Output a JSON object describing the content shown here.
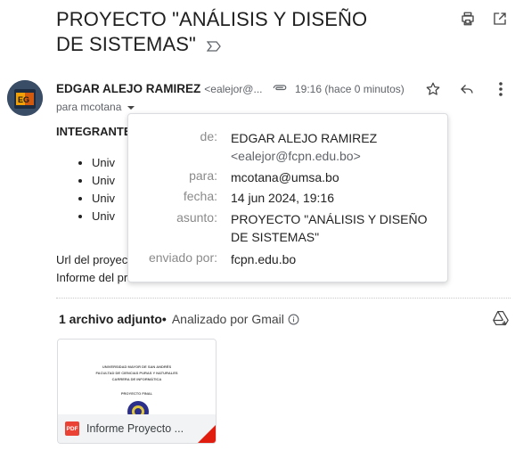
{
  "email": {
    "subject": "PROYECTO \"ANÁLISIS Y DISEÑO DE SISTEMAS\"",
    "sender_name": "EDGAR ALEJO RAMIREZ",
    "sender_email_truncated": "<ealejor@...",
    "time": "19:16 (hace 0 minutos)",
    "to_summary": "para mcotana",
    "avatar_initials": "EG"
  },
  "body": {
    "integrantes": "INTEGRANTE",
    "list_items": [
      "Univ",
      "Univ",
      "Univ",
      "Univ"
    ],
    "url_line": "Url del proyec",
    "informe_line": "Informe del pr"
  },
  "details_popup": {
    "from_label": "de:",
    "from_name": "EDGAR ALEJO RAMIREZ",
    "from_email": "<ealejor@fcpn.edu.bo>",
    "to_label": "para:",
    "to_value": "mcotana@umsa.bo",
    "date_label": "fecha:",
    "date_value": "14 jun 2024, 19:16",
    "subject_label": "asunto:",
    "subject_value": "PROYECTO \"ANÁLISIS Y DISEÑO DE SISTEMAS\"",
    "mailed_by_label": "enviado por:",
    "mailed_by_value": "fcpn.edu.bo"
  },
  "attachments": {
    "count_label": "1 archivo adjunto",
    "separator": "•",
    "scan_label": "Analizado por Gmail",
    "file": {
      "type_badge": "PDF",
      "name": "Informe Proyecto ...",
      "preview_lines": [
        "UNIVERSIDAD MAYOR DE SAN ANDRÉS",
        "FACULTAD DE CIENCIAS PURAS Y NATURALES",
        "CARRERA DE INFORMÁTICA",
        "PROYECTO FINAL"
      ]
    }
  },
  "icons": {
    "print": "print-icon",
    "open_new_window": "open-in-new-window-icon",
    "label": "label-important-icon",
    "paperclip": "paperclip-icon",
    "star": "star-icon",
    "reply": "reply-icon",
    "more": "more-vertical-icon",
    "dropdown": "caret-down-icon",
    "info": "info-icon",
    "add_to_drive": "add-to-drive-icon"
  },
  "colors": {
    "pdf_red": "#ea4335",
    "text_primary": "#1f1f1f",
    "text_secondary": "#5f6368"
  }
}
